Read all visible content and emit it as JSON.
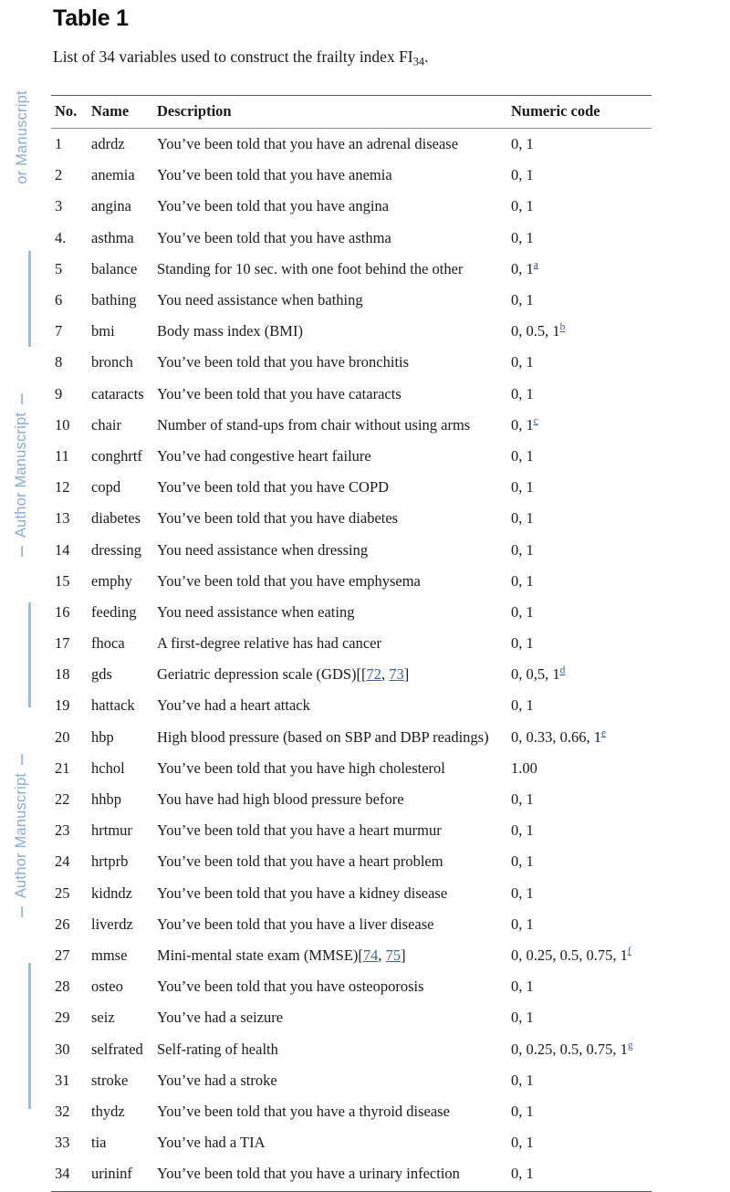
{
  "watermark": {
    "label": "Author Manuscript",
    "color": "#88acd6",
    "blocks": [
      {
        "label": "or Manuscript"
      },
      {
        "label": "Author Manuscript"
      },
      {
        "label": "Author Manuscript"
      }
    ]
  },
  "document": {
    "title": "Table 1",
    "caption_before": "List of 34 variables used to construct the frailty index FI",
    "caption_subscript": "34",
    "caption_after": "."
  },
  "table": {
    "columns": [
      {
        "key": "no",
        "label": "No."
      },
      {
        "key": "name",
        "label": "Name"
      },
      {
        "key": "desc",
        "label": "Description"
      },
      {
        "key": "code",
        "label": "Numeric code"
      }
    ],
    "rows": [
      {
        "no": "1",
        "name": "adrdz",
        "desc": "You’ve been told that you have an adrenal disease",
        "code": "0, 1",
        "footnote": "",
        "refs": []
      },
      {
        "no": "2",
        "name": "anemia",
        "desc": "You’ve been told that you have anemia",
        "code": "0, 1",
        "footnote": "",
        "refs": []
      },
      {
        "no": "3",
        "name": "angina",
        "desc": "You’ve been told that you have angina",
        "code": "0, 1",
        "footnote": "",
        "refs": []
      },
      {
        "no": "4.",
        "name": "asthma",
        "desc": "You’ve been told that you have asthma",
        "code": "0, 1",
        "footnote": "",
        "refs": []
      },
      {
        "no": "5",
        "name": "balance",
        "desc": "Standing for 10 sec. with one foot behind the other",
        "code": "0, 1",
        "footnote": "a",
        "refs": []
      },
      {
        "no": "6",
        "name": "bathing",
        "desc": "You need assistance when bathing",
        "code": "0, 1",
        "footnote": "",
        "refs": []
      },
      {
        "no": "7",
        "name": "bmi",
        "desc": "Body mass index (BMI)",
        "code": "0, 0.5, 1",
        "footnote": "b",
        "refs": []
      },
      {
        "no": "8",
        "name": "bronch",
        "desc": "You’ve been told that you have bronchitis",
        "code": "0, 1",
        "footnote": "",
        "refs": []
      },
      {
        "no": "9",
        "name": "cataracts",
        "desc": "You’ve been told that you have cataracts",
        "code": "0, 1",
        "footnote": "",
        "refs": []
      },
      {
        "no": "10",
        "name": "chair",
        "desc": "Number of stand-ups from chair without using arms",
        "code": "0, 1",
        "footnote": "c",
        "refs": []
      },
      {
        "no": "11",
        "name": "conghrtf",
        "desc": "You’ve had congestive heart failure",
        "code": "0, 1",
        "footnote": "",
        "refs": []
      },
      {
        "no": "12",
        "name": "copd",
        "desc": "You’ve been told that you have COPD",
        "code": "0, 1",
        "footnote": "",
        "refs": []
      },
      {
        "no": "13",
        "name": "diabetes",
        "desc": "You’ve been told that you have diabetes",
        "code": "0, 1",
        "footnote": "",
        "refs": []
      },
      {
        "no": "14",
        "name": "dressing",
        "desc": "You need assistance when dressing",
        "code": "0, 1",
        "footnote": "",
        "refs": []
      },
      {
        "no": "15",
        "name": "emphy",
        "desc": "You’ve been told that you have emphysema",
        "code": "0, 1",
        "footnote": "",
        "refs": []
      },
      {
        "no": "16",
        "name": "feeding",
        "desc": "You need assistance when eating",
        "code": "0, 1",
        "footnote": "",
        "refs": []
      },
      {
        "no": "17",
        "name": "fhoca",
        "desc": "A first-degree relative has had cancer",
        "code": "0, 1",
        "footnote": "",
        "refs": []
      },
      {
        "no": "18",
        "name": "gds",
        "desc": "Geriatric depression scale (GDS)[[",
        "code": "0, 0,5, 1",
        "footnote": "d",
        "refs": [
          "72",
          "73"
        ],
        "desc_tail": "]"
      },
      {
        "no": "19",
        "name": "hattack",
        "desc": "You’ve had a heart attack",
        "code": "0, 1",
        "footnote": "",
        "refs": []
      },
      {
        "no": "20",
        "name": "hbp",
        "desc": "High blood pressure (based on SBP and DBP readings)",
        "code": "0, 0.33, 0.66, 1",
        "footnote": "e",
        "refs": []
      },
      {
        "no": "21",
        "name": "hchol",
        "desc": "You’ve been told that you have high cholesterol",
        "code": "1.00",
        "footnote": "",
        "refs": []
      },
      {
        "no": "22",
        "name": "hhbp",
        "desc": "You have had high blood pressure before",
        "code": "0, 1",
        "footnote": "",
        "refs": []
      },
      {
        "no": "23",
        "name": "hrtmur",
        "desc": "You’ve been told that you have a heart murmur",
        "code": "0, 1",
        "footnote": "",
        "refs": []
      },
      {
        "no": "24",
        "name": "hrtprb",
        "desc": "You’ve been told that you have a heart problem",
        "code": "0, 1",
        "footnote": "",
        "refs": []
      },
      {
        "no": "25",
        "name": "kidndz",
        "desc": "You’ve been told that you have a kidney disease",
        "code": "0, 1",
        "footnote": "",
        "refs": []
      },
      {
        "no": "26",
        "name": "liverdz",
        "desc": "You’ve been told that you have a liver disease",
        "code": "0, 1",
        "footnote": "",
        "refs": []
      },
      {
        "no": "27",
        "name": "mmse",
        "desc": "Mini-mental state exam (MMSE)[",
        "code": "0, 0.25, 0.5, 0.75, 1",
        "footnote": "f",
        "refs": [
          "74",
          "75"
        ],
        "desc_tail": "]"
      },
      {
        "no": "28",
        "name": "osteo",
        "desc": "You’ve been told that you have osteoporosis",
        "code": "0, 1",
        "footnote": "",
        "refs": []
      },
      {
        "no": "29",
        "name": "seiz",
        "desc": "You’ve had a seizure",
        "code": "0, 1",
        "footnote": "",
        "refs": []
      },
      {
        "no": "30",
        "name": "selfrated",
        "desc": "Self-rating of health",
        "code": "0, 0.25, 0.5, 0.75, 1",
        "footnote": "g",
        "refs": []
      },
      {
        "no": "31",
        "name": "stroke",
        "desc": "You’ve had a stroke",
        "code": "0, 1",
        "footnote": "",
        "refs": []
      },
      {
        "no": "32",
        "name": "thydz",
        "desc": "You’ve been told that you have a thyroid disease",
        "code": "0, 1",
        "footnote": "",
        "refs": []
      },
      {
        "no": "33",
        "name": "tia",
        "desc": "You’ve had a TIA",
        "code": "0, 1",
        "footnote": "",
        "refs": []
      },
      {
        "no": "34",
        "name": "urininf",
        "desc": "You’ve been told that you have a urinary infection",
        "code": "0, 1",
        "footnote": "",
        "refs": []
      }
    ]
  }
}
